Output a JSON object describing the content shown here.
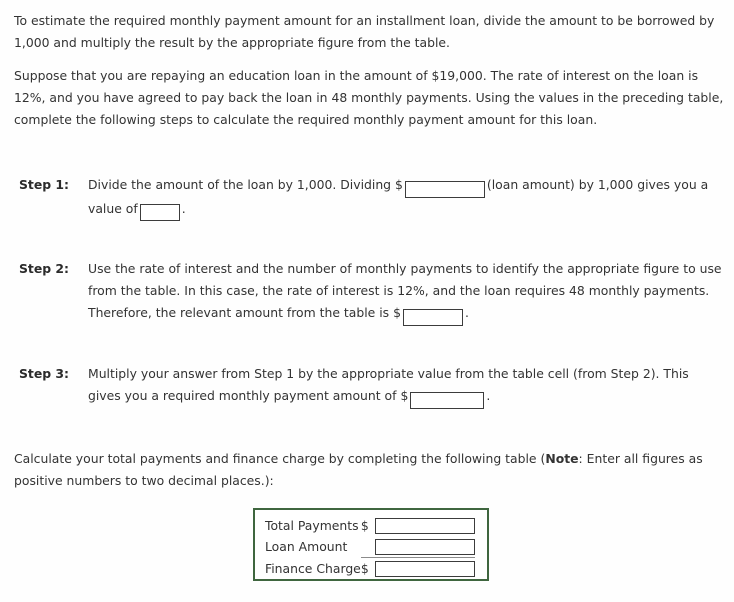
{
  "intro": {
    "paragraph": "To estimate the required monthly payment amount for an installment loan, divide the amount to be borrowed by 1,000 and multiply the result by the appropriate figure from the table.",
    "scenario": "Suppose that you are repaying an education loan in the amount of $19,000. The rate of interest on the loan is 12%, and you have agreed to pay back the loan in 48 monthly payments. Using the values in the preceding table, complete the following steps to calculate the required monthly payment amount for this loan."
  },
  "steps": [
    {
      "label": "Step 1:",
      "text_before_input": "Divide the amount of the loan by 1,000. Dividing $",
      "text_after_input": "(loan amount) by 1,000 gives you a value of",
      "text_end": ".",
      "input_value": "",
      "input2_value": ""
    },
    {
      "label": "Step 2:",
      "text_before_input": "Use the rate of interest and the number of monthly payments to identify the appropriate figure to use from the table. In this case, the rate of interest is 12%, and the loan requires 48 monthly payments. Therefore, the relevant amount from the table is $",
      "text_end": ".",
      "input_value": ""
    },
    {
      "label": "Step 3:",
      "text_before_input": "Multiply your answer from Step 1 by the appropriate value from the table cell (from Step 2). This gives you a required monthly payment amount of $",
      "text_end": ".",
      "input_value": ""
    }
  ],
  "calc_instruction": {
    "part1": "Calculate your total payments and finance charge by completing the following table (",
    "note_label": "Note",
    "part2": ": Enter all figures as positive numbers to two decimal places.):"
  },
  "finance_table": {
    "border_color": "#3f663f",
    "rows": [
      {
        "label": "Total Payments",
        "symbol": "$",
        "value": "",
        "has_rule": false
      },
      {
        "label": "Loan Amount",
        "symbol": "",
        "value": "",
        "has_rule": true
      },
      {
        "label": "Finance Charge",
        "symbol": "$",
        "value": "",
        "has_rule": false
      }
    ]
  }
}
